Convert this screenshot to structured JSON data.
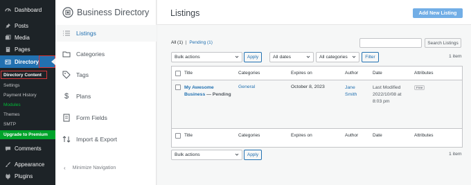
{
  "wp_menu": {
    "dashboard": "Dashboard",
    "posts": "Posts",
    "media": "Media",
    "pages": "Pages",
    "directory": "Directory",
    "sub": {
      "directory_content": "Directory Content",
      "settings": "Settings",
      "payment_history": "Payment History",
      "modules": "Modules",
      "themes": "Themes",
      "smtp": "SMTP",
      "upgrade": "Upgrade to Premium"
    },
    "comments": "Comments",
    "appearance": "Appearance",
    "plugins": "Plugins"
  },
  "bd_nav": {
    "brand": "Business Directory",
    "items": [
      "Listings",
      "Categories",
      "Tags",
      "Plans",
      "Form Fields",
      "Import & Export"
    ],
    "minimize": "Minimize Navigation"
  },
  "header": {
    "title": "Listings",
    "add_new": "Add New Listing"
  },
  "filters": {
    "all": "All",
    "all_count": "(1)",
    "separator": "|",
    "pending": "Pending",
    "pending_count": "(1)",
    "search_button": "Search Listings",
    "bulk_actions": "Bulk actions",
    "apply": "Apply",
    "dates": "All dates",
    "categories": "All categories",
    "filter": "Filter",
    "items_count": "1 item"
  },
  "table": {
    "columns": [
      "Title",
      "Categories",
      "Expires on",
      "Author",
      "Date",
      "Attributes"
    ],
    "row": {
      "title": "My Awesome Business",
      "status": " — Pending",
      "category": "General",
      "expires": "October 8, 2023",
      "author": "Jane Smith",
      "date": "Last Modified 2022/10/08 at 8:03 pm",
      "badge": "Free"
    }
  },
  "bottom": {
    "bulk_actions": "Bulk actions",
    "apply": "Apply",
    "items_count": "1 item"
  },
  "colors": {
    "wp_sidebar": "#1d2327",
    "accent": "#2271b1",
    "highlight_outline": "#d63638",
    "premium": "#00a32a",
    "add_button": "#72aee6"
  }
}
